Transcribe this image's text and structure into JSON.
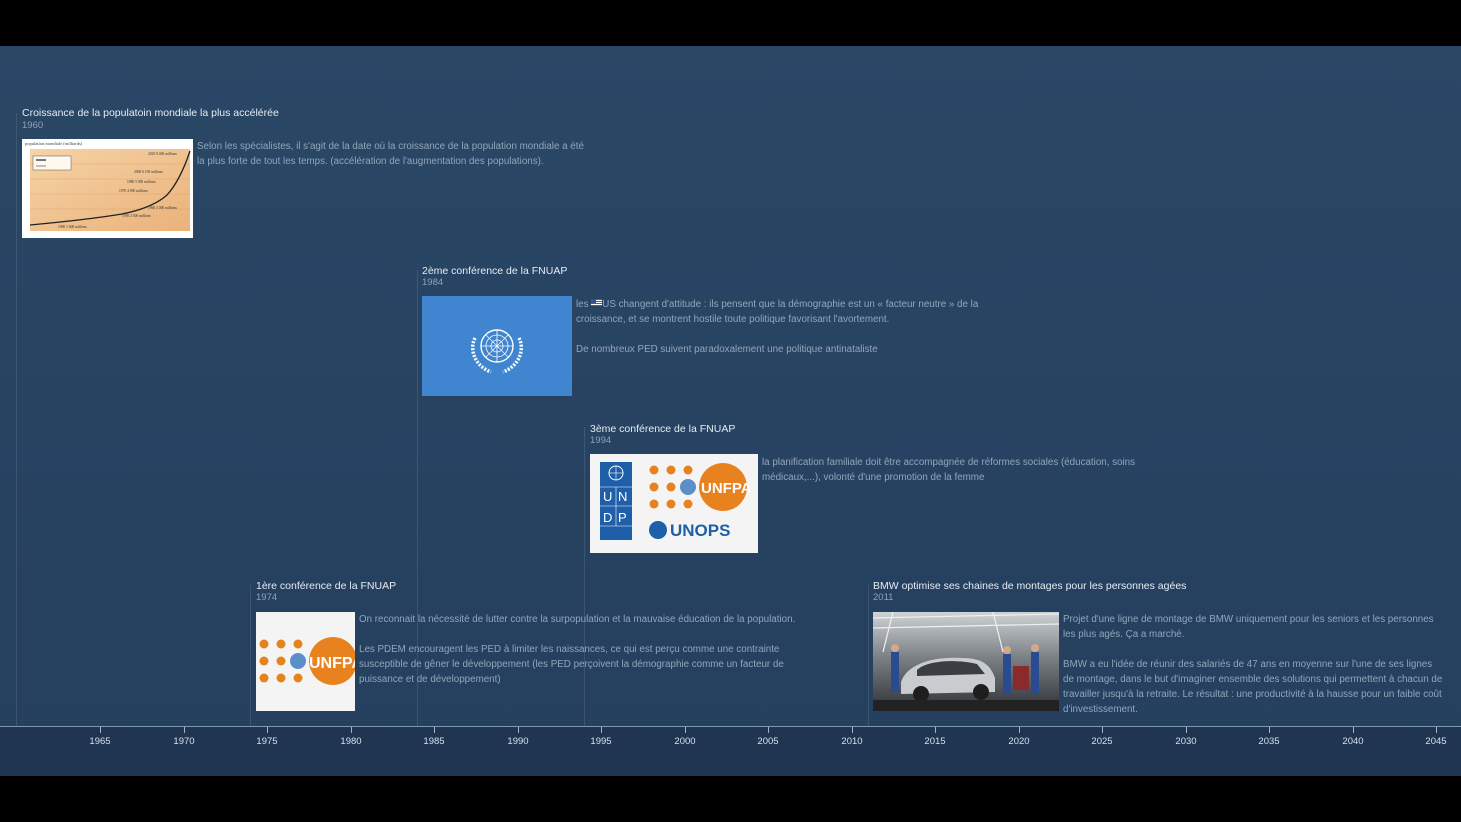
{
  "events": {
    "e1960": {
      "title": "Croissance de la populatoin mondiale la plus accélérée",
      "year": "1960",
      "paragraphs": [
        "Selon les spécialistes, il s'agit de la date où la croissance de la population mondiale a été la plus forte de tout les temps. (accélération de l'augmentation des popula­tions)."
      ]
    },
    "e1984": {
      "title": "2ème conférence de la FNUAP",
      "year": "1984",
      "para1_before": "les ",
      "para1_after": "US changent d'attitude : ils pensent que la démographie est un « facteur neutre » de la croissance, et se montrent hostile  toute politique favorisant l'avortement.",
      "para2": "De nombreux PED suivent paradoxalement une politique antinataliste"
    },
    "e1994": {
      "title": "3ème conférence de la FNUAP",
      "year": "1994",
      "para1": "la planification familiale doit être accompagnée de réformes sociales (éducation, soins médicaux,...), volonté d'une promotion de la femme"
    },
    "e1974": {
      "title": "1ère conférence de la FNUAP",
      "year": "1974",
      "para1": "On reconnait la nécessité de lutter contre la surpopulation et la mauvaise éducation de la popula­tion.",
      "para2": "Les PDEM encouragent les PED à limiter les naissances, ce qui est perçu comme une contrainte susceptible de gêner le développement (les PED perçoivent la démographie comme un facteur de puissance et de développement)"
    },
    "e2011": {
      "title": "BMW optimise ses chaines de montages pour les personnes agées",
      "year": "2011",
      "para1": "Projet d'une ligne de montage de BMW uniquement pour les seniors et les personnes les plus agés. Ça a marché.",
      "para2": "BMW a eu l'idée de réunir des salariés de 47 ans en moyenne sur l'une de ses lignes de montage, dans le but d'imaginer ensemble des solutions qui permettent à chacun de travailler jusqu'à la retraite. Le résultat : une productivité à la hausse pour un faible coût d'investissement."
    }
  },
  "images": {
    "chart_label": "population mondiale (milliards)",
    "chart_annotations": [
      "2025 8 400 millions",
      "2000 6 100 millions",
      "1980 5 000 millions",
      "1970 4 000 millions",
      "1960 3 000 millions",
      "1950 2 500 millions",
      "1900 1 600 millions"
    ],
    "undp_letters": [
      "U",
      "N",
      "D",
      "P"
    ],
    "unfpa_text": "UNFPA",
    "unops_text": "UNOPS"
  },
  "axis": {
    "ticks": [
      "1965",
      "1970",
      "1975",
      "1980",
      "1985",
      "1990",
      "1995",
      "2000",
      "2005",
      "2010",
      "2015",
      "2020",
      "2025",
      "2030",
      "2035",
      "2040",
      "2045"
    ]
  },
  "colors": {
    "background": "#2a4766",
    "axis_bar": "#1f3552",
    "un_blue": "#3f85d0",
    "unfpa_orange": "#e8821f",
    "undp_blue": "#1f5ea8"
  }
}
